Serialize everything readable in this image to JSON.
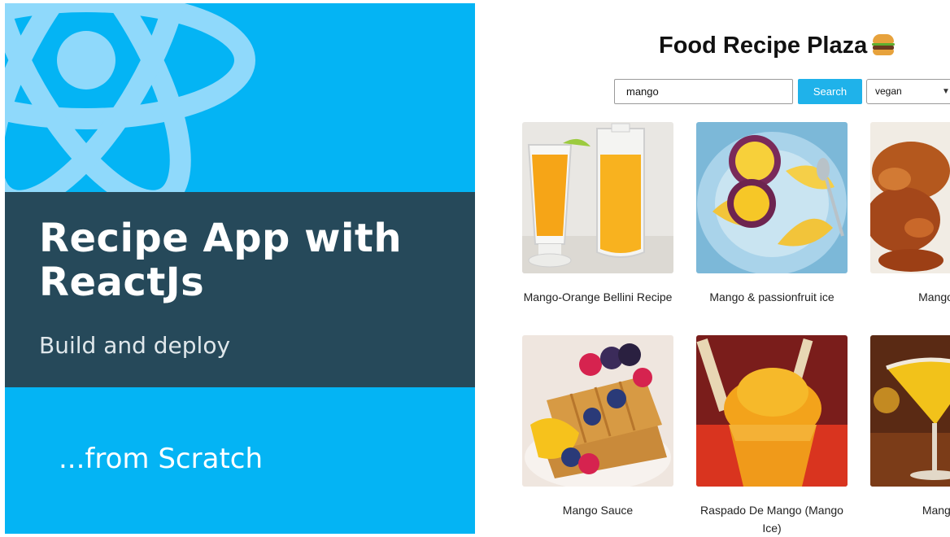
{
  "promo": {
    "title": "Recipe App with ReactJs",
    "subtitle": "Build and deploy",
    "tagline": "...from Scratch",
    "colors": {
      "background": "#04b4f4",
      "band": "#26495a"
    }
  },
  "app": {
    "title": "Food Recipe Plaza",
    "title_icon": "burger-icon",
    "search": {
      "value": "mango",
      "button_label": "Search"
    },
    "diet_filter": {
      "selected": "vegan"
    },
    "accent_color": "#1fb2ea",
    "recipes": [
      {
        "label": "Mango-Orange Bellini Recipe",
        "image": "bellini-photo"
      },
      {
        "label": "Mango & passionfruit ice",
        "image": "passionfruit-ice-photo"
      },
      {
        "label": "Mango Rie",
        "image": "roast-chicken-photo"
      },
      {
        "label": "Mango Sauce",
        "image": "waffle-berries-photo"
      },
      {
        "label": "Raspado De Mango (Mango Ice)",
        "image": "mango-ice-cup-photo"
      },
      {
        "label": "Mango M",
        "image": "mango-margarita-photo"
      }
    ]
  }
}
